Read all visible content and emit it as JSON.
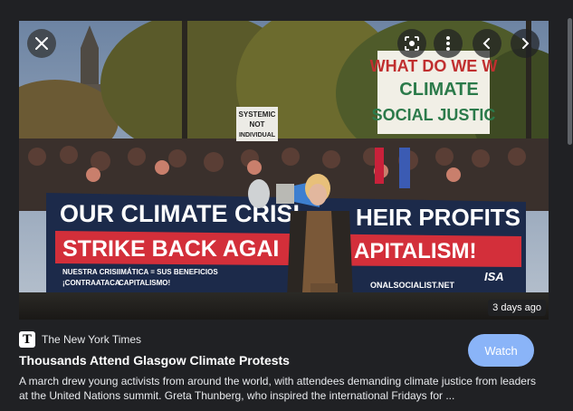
{
  "media": {
    "time_ago": "3 days ago",
    "image_alt": "Protesters holding a banner and signs in Glasgow",
    "banner": {
      "line1_left": "OUR CLIMATE CRISI",
      "line1_right": "HEIR PROFITS",
      "line2_left": "STRIKE BACK AGAI",
      "line2_right": "APITALISM!",
      "line3_left": "NUESTRA CRISI",
      "line3_mid": "IMÁTICA = SUS BENEFICIOS",
      "line3_left2": "¡CONTRAATACA",
      "line3_mid2": "CAPITALISMO!",
      "line3_right": "ONALSOCIALIST.NET",
      "logo": "ISA"
    },
    "sign_right": {
      "l1": "WHAT DO WE W",
      "l2": "CLIMATE",
      "l3": "SOCIAL JUSTIC"
    },
    "sign_left": {
      "l1": "SYSTEMIC",
      "l2": "NOT",
      "l3": "INDIVIDUAL"
    }
  },
  "controls": {
    "close_icon": "close-icon",
    "lens_icon": "lens-icon",
    "more_icon": "more-vert-icon",
    "prev_icon": "chevron-left-icon",
    "next_icon": "chevron-right-icon"
  },
  "source": {
    "logo_letter": "T",
    "name": "The New York Times"
  },
  "article": {
    "title": "Thousands Attend Glasgow Climate Protests",
    "description": "A march drew young activists from around the world, with attendees demanding climate justice from leaders at the United Nations summit. Greta Thunberg, who inspired the international Fridays for ..."
  },
  "watch_label": "Watch",
  "colors": {
    "accent": "#8ab4f8",
    "background": "#202124",
    "banner_red": "#d32f3a",
    "banner_navy": "#1c2a4a"
  }
}
